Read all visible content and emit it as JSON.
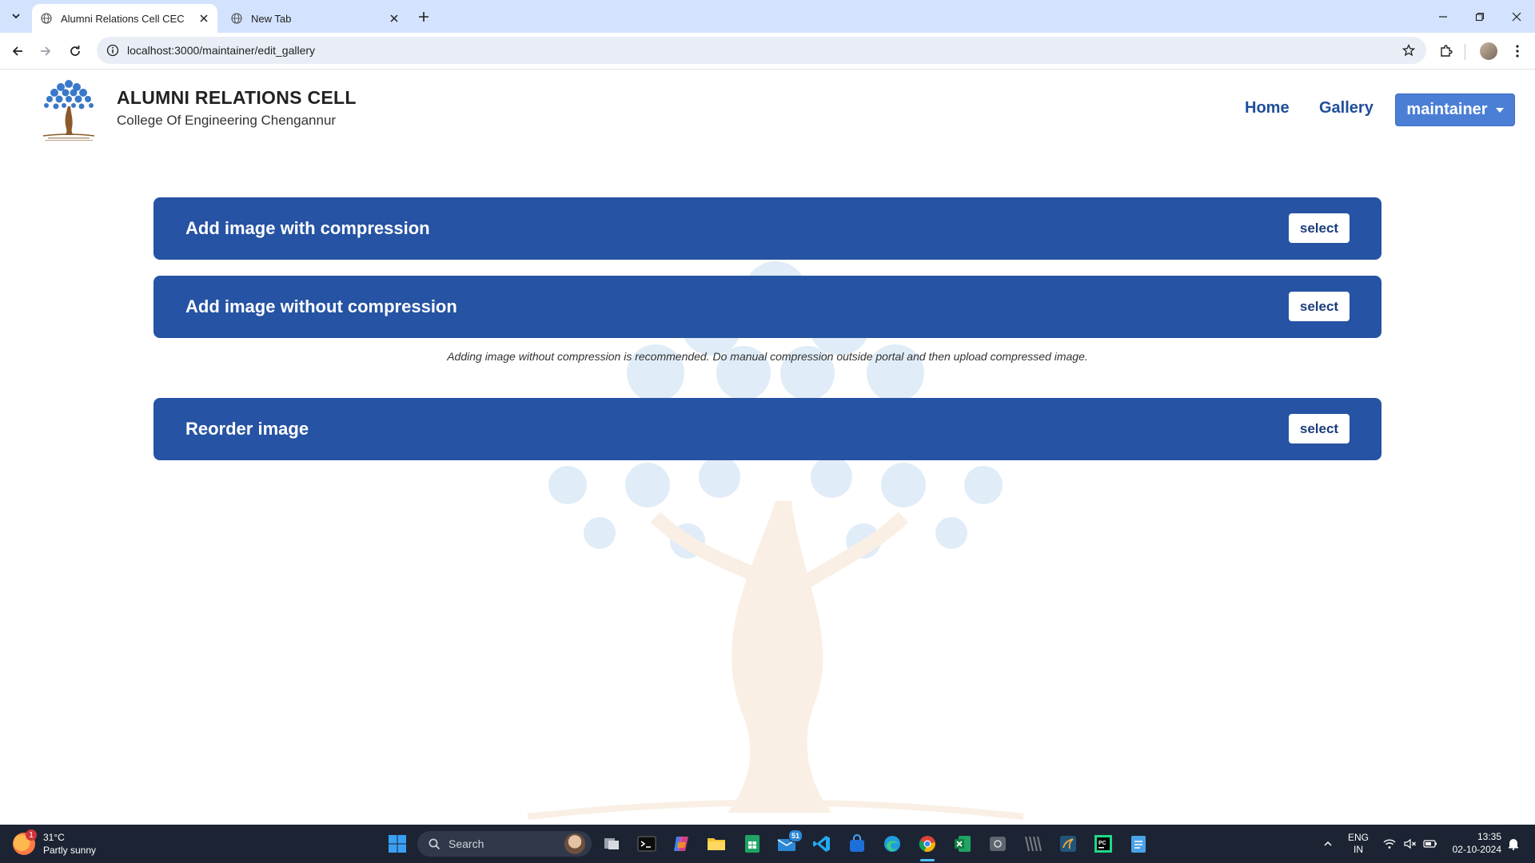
{
  "browser": {
    "tabs": [
      {
        "title": "Alumni Relations Cell CEC",
        "active": true
      },
      {
        "title": "New Tab",
        "active": false
      }
    ],
    "url": "localhost:3000/maintainer/edit_gallery"
  },
  "site": {
    "title": "ALUMNI RELATIONS CELL",
    "subtitle": "College Of Engineering Chengannur",
    "nav": {
      "home": "Home",
      "gallery": "Gallery",
      "user_menu": "maintainer"
    }
  },
  "actions": [
    {
      "label": "Add image with compression",
      "button": "select"
    },
    {
      "label": "Add image without compression",
      "button": "select"
    },
    {
      "label": "Reorder image",
      "button": "select"
    }
  ],
  "note": "Adding image without compression is recommended. Do manual compression outside portal and then upload compressed image.",
  "taskbar": {
    "weather_temp": "31°C",
    "weather_desc": "Partly sunny",
    "weather_badge": "1",
    "search_placeholder": "Search",
    "mail_badge": "51",
    "lang_top": "ENG",
    "lang_bottom": "IN",
    "time": "13:35",
    "date": "02-10-2024"
  },
  "colors": {
    "card_bg": "#2653a3",
    "nav_link": "#1f4e9a",
    "maintainer_btn": "#4b7fd6",
    "tabstrip": "#d3e3fd"
  }
}
